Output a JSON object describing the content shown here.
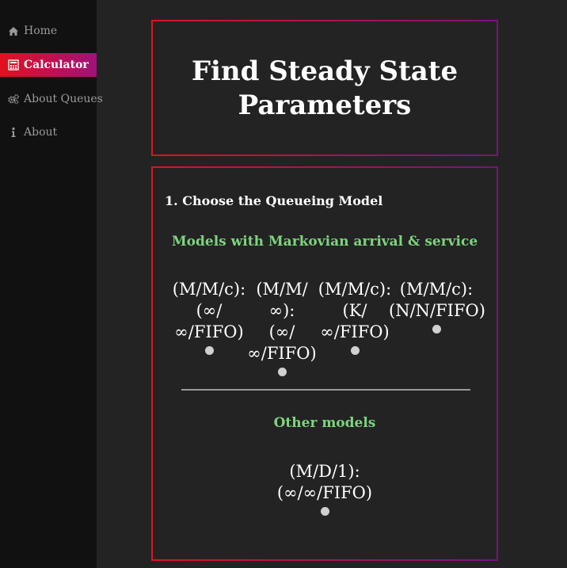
{
  "sidebar": {
    "items": [
      {
        "label": "Home",
        "icon": "home-icon"
      },
      {
        "label": "Calculator",
        "icon": "calculator-icon"
      },
      {
        "label": "About Queues",
        "icon": "gears-icon"
      },
      {
        "label": "About",
        "icon": "info-icon"
      }
    ],
    "active_index": 1
  },
  "header": {
    "title": "Find Steady State Parameters"
  },
  "step": {
    "heading": "1. Choose the Queueing Model"
  },
  "markovian": {
    "heading": "Models with Markovian arrival & service",
    "models": [
      {
        "line1": "(M/M/c):",
        "line2": "(∞/",
        "line3": "∞/FIFO)"
      },
      {
        "line1": "(M/M/∞):",
        "line2": "(∞/",
        "line3": "∞/FIFO)"
      },
      {
        "line1": "(M/M/c):",
        "line2": "(K/",
        "line3": "∞/FIFO)"
      },
      {
        "line1": "(M/M/c):",
        "line2": "(N/N/FIFO)"
      }
    ]
  },
  "other": {
    "heading": "Other models",
    "models": [
      {
        "line1": "(M/D/1):",
        "line2": "(∞/∞/FIFO)"
      }
    ]
  },
  "colors": {
    "background": "#232323",
    "sidebar": "#111111",
    "accent_start": "#e0121f",
    "accent_end": "#a0127a",
    "section_heading": "#7ed47e",
    "radio": "#d0d0d0"
  }
}
